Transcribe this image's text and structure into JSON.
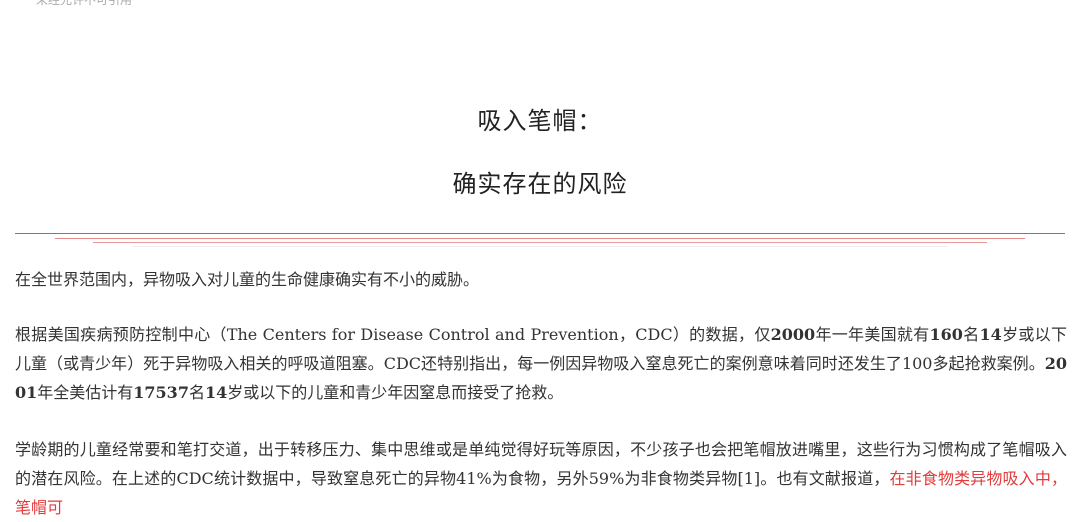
{
  "top_note": "未经允许不可引用",
  "title": {
    "line1": "吸入笔帽：",
    "line2": "确实存在的风险"
  },
  "paragraphs": {
    "p1": "在全世界范围内，异物吸入对儿童的生命健康确实有不小的威胁。",
    "p2": {
      "s1": "根据美国疾病预防控制中心（The Centers for Disease Control and Prevention，CDC）的数据，仅",
      "b1": "2000",
      "s2": "年一年美国就有",
      "b2": "160",
      "s3": "名",
      "b3": "14",
      "s4": "岁或以下儿童（或青少年）死于异物吸入相关的呼吸道阻塞。CDC还特别指出，每一例因异物吸入窒息死亡的案例意味着同时还发生了100多起抢救案例。",
      "b4": "2001",
      "s5": "年全美估计有",
      "b5": "17537",
      "s6": "名",
      "b6": "14",
      "s7": "岁或以下的儿童和青少年因窒息而接受了抢救。"
    },
    "p3": {
      "s1": "学龄期的儿童经常要和笔打交道，出于转移压力、集中思维或是单纯觉得好玩等原因，不少孩子也会把笔帽放进嘴里，这些行为习惯构成了笔帽吸入的潜在风险。在上述的CDC统计数据中，导致窒息死亡的异物41%为食物，另外59%为非食物类异物[1]。也有文献报道，",
      "highlight": "在非食物类异物吸入中，笔帽可"
    }
  },
  "colors": {
    "text": "#333333",
    "highlight": "#e23b3b",
    "rule_red": "#d9534f"
  }
}
